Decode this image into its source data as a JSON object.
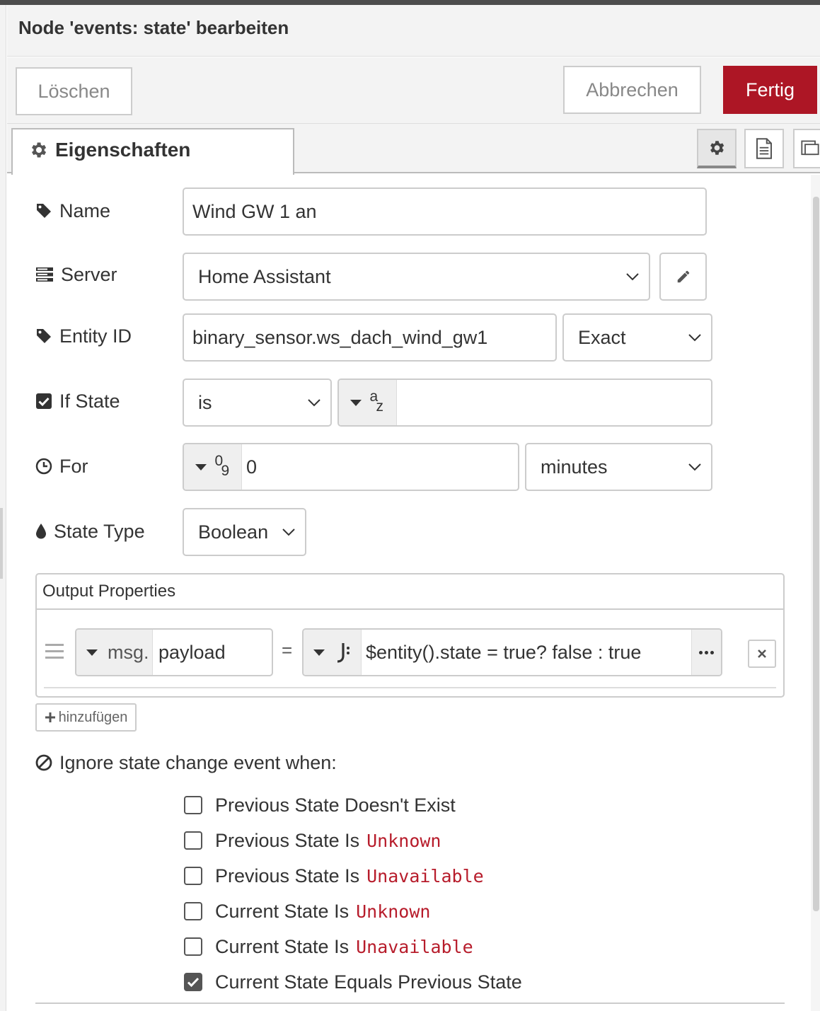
{
  "dialog": {
    "title": "Node 'events: state' bearbeiten",
    "delete_label": "Löschen",
    "cancel_label": "Abbrechen",
    "done_label": "Fertig",
    "accent_color": "#ad1625"
  },
  "tabs": {
    "properties_label": "Eigenschaften",
    "icons": [
      "gear-icon",
      "description-icon",
      "appearance-icon"
    ]
  },
  "form": {
    "name": {
      "label": "Name",
      "value": "Wind GW 1 an"
    },
    "server": {
      "label": "Server",
      "value": "Home Assistant"
    },
    "entity_id": {
      "label": "Entity ID",
      "value": "binary_sensor.ws_dach_wind_gw1",
      "match": "Exact"
    },
    "if_state": {
      "label": "If State",
      "checked": true,
      "operator": "is",
      "type_glyph_top": "a",
      "type_glyph_bottom": "z",
      "value": ""
    },
    "for": {
      "label": "For",
      "type_glyph_top": "0",
      "type_glyph_bottom": "9",
      "value": "0",
      "unit": "minutes"
    },
    "state_type": {
      "label": "State Type",
      "value": "Boolean"
    }
  },
  "output": {
    "header": "Output Properties",
    "row": {
      "prefix": "msg.",
      "property": "payload",
      "equals": "=",
      "expression": "$entity().state = true? false : true"
    },
    "add_label": "hinzufügen"
  },
  "ignore": {
    "heading": "Ignore state change event when:",
    "options": [
      {
        "text": "Previous State Doesn't Exist",
        "code": "",
        "checked": false
      },
      {
        "text": "Previous State Is",
        "code": "Unknown",
        "checked": false
      },
      {
        "text": "Previous State Is",
        "code": "Unavailable",
        "checked": false
      },
      {
        "text": "Current State Is",
        "code": "Unknown",
        "checked": false
      },
      {
        "text": "Current State Is",
        "code": "Unavailable",
        "checked": false
      },
      {
        "text": "Current State Equals Previous State",
        "code": "",
        "checked": true
      }
    ]
  }
}
